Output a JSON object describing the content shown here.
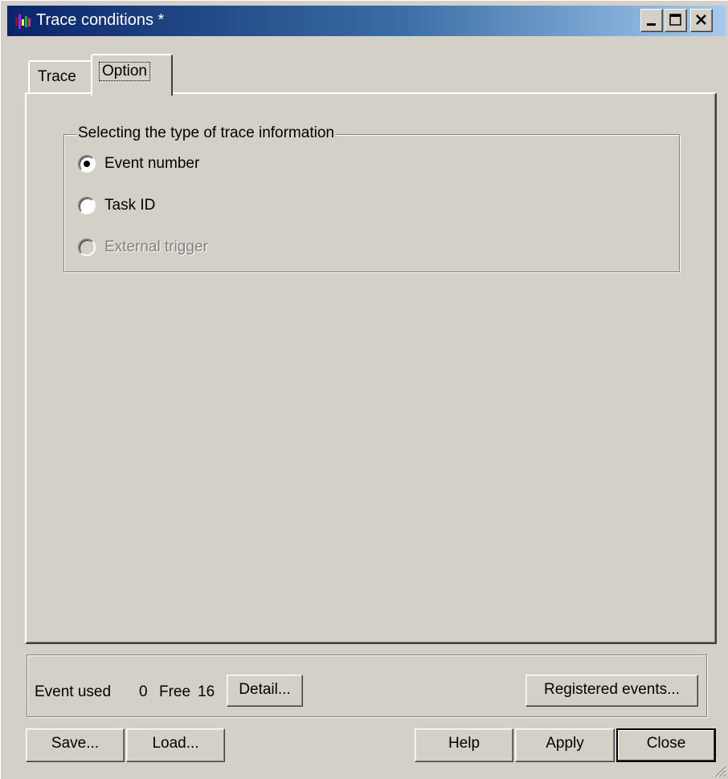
{
  "window": {
    "title": "Trace conditions *",
    "icon": "app-icon",
    "controls": {
      "minimize": "minimize-icon",
      "maximize": "maximize-icon",
      "close": "close-icon"
    }
  },
  "tabs": [
    {
      "label": "Trace",
      "active": false
    },
    {
      "label": "Option",
      "active": true
    }
  ],
  "option": {
    "group_label": "Selecting the type of trace information",
    "radios": [
      {
        "label": "Event number",
        "selected": true,
        "enabled": true
      },
      {
        "label": "Task ID",
        "selected": false,
        "enabled": true
      },
      {
        "label": "External trigger",
        "selected": false,
        "enabled": false
      }
    ]
  },
  "status": {
    "event_used_label": "Event used",
    "event_used_value": "0",
    "free_label": "Free",
    "free_value": "16",
    "detail_button": "Detail...",
    "registered_button": "Registered events..."
  },
  "footer": {
    "save": "Save...",
    "load": "Load...",
    "help": "Help",
    "apply": "Apply",
    "close": "Close"
  },
  "colors": {
    "face": "#d4d0c8",
    "title_start": "#0a246a",
    "title_end": "#a6caf0",
    "disabled_text": "#808080"
  }
}
